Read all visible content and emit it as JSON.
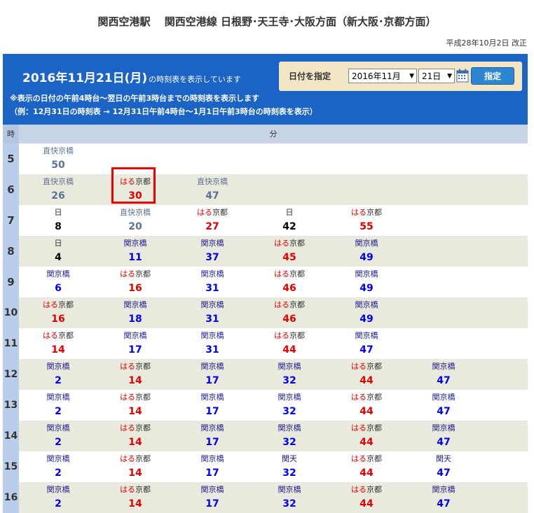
{
  "header": {
    "title": "関西空港駅　 関西空港線  日根野･天王寺･大阪方面（新大阪･京都方面）",
    "revised": "平成28年10月2日  改正"
  },
  "panel": {
    "date": "2016年11月21日(月)",
    "date_suffix": "の時刻表を表示しています",
    "note1": "※表示の日付の午前4時台～翌日の午前3時台までの時刻表を表示します",
    "note2": "（例：12月31日の時刻表  →  12月31日午前4時台～1月1日午前3時台の時刻表を表示）",
    "date_label": "日付を指定",
    "month_value": "2016年11月",
    "day_value": "21日",
    "submit_label": "指定"
  },
  "table": {
    "hour_header": "時",
    "minute_header": "分",
    "rows": [
      {
        "hour": "5",
        "cells": [
          {
            "type": "exp",
            "label": "直快京橋",
            "min": "50"
          }
        ]
      },
      {
        "hour": "6",
        "cells": [
          {
            "type": "exp",
            "label": "直快京橋",
            "min": "26"
          },
          {
            "type": "haruka",
            "label": "はる",
            "dest": "京都",
            "min": "30"
          },
          {
            "type": "exp",
            "label": "直快京橋",
            "min": "47"
          }
        ]
      },
      {
        "hour": "7",
        "cells": [
          {
            "type": "sun",
            "label": "日",
            "min": "8"
          },
          {
            "type": "exp",
            "label": "直快京橋",
            "min": "20"
          },
          {
            "type": "haruka",
            "label": "はる",
            "dest": "京都",
            "min": "27"
          },
          {
            "type": "sun",
            "label": "日",
            "min": "42"
          },
          {
            "type": "haruka",
            "label": "はる",
            "dest": "京都",
            "min": "55"
          }
        ]
      },
      {
        "hour": "8",
        "cells": [
          {
            "type": "sun",
            "label": "日",
            "min": "4"
          },
          {
            "type": "kanku",
            "label": "関京橋",
            "min": "11"
          },
          {
            "type": "kanku",
            "label": "関京橋",
            "min": "37"
          },
          {
            "type": "haruka",
            "label": "はる",
            "dest": "京都",
            "min": "45"
          },
          {
            "type": "kanku",
            "label": "関京橋",
            "min": "49"
          }
        ]
      },
      {
        "hour": "9",
        "cells": [
          {
            "type": "kanku",
            "label": "関京橋",
            "min": "6"
          },
          {
            "type": "haruka",
            "label": "はる",
            "dest": "京都",
            "min": "16"
          },
          {
            "type": "kanku",
            "label": "関京橋",
            "min": "31"
          },
          {
            "type": "haruka",
            "label": "はる",
            "dest": "京都",
            "min": "46"
          },
          {
            "type": "kanku",
            "label": "関京橋",
            "min": "49"
          }
        ]
      },
      {
        "hour": "10",
        "cells": [
          {
            "type": "haruka",
            "label": "はる",
            "dest": "京都",
            "min": "16"
          },
          {
            "type": "kanku",
            "label": "関京橋",
            "min": "18"
          },
          {
            "type": "kanku",
            "label": "関京橋",
            "min": "31"
          },
          {
            "type": "haruka",
            "label": "はる",
            "dest": "京都",
            "min": "46"
          },
          {
            "type": "kanku",
            "label": "関京橋",
            "min": "49"
          }
        ]
      },
      {
        "hour": "11",
        "cells": [
          {
            "type": "haruka",
            "label": "はる",
            "dest": "京都",
            "min": "14"
          },
          {
            "type": "kanku",
            "label": "関京橋",
            "min": "17"
          },
          {
            "type": "kanku",
            "label": "関京橋",
            "min": "31"
          },
          {
            "type": "haruka",
            "label": "はる",
            "dest": "京都",
            "min": "44"
          },
          {
            "type": "kanku",
            "label": "関京橋",
            "min": "47"
          }
        ]
      },
      {
        "hour": "12",
        "cells": [
          {
            "type": "kanku",
            "label": "関京橋",
            "min": "2"
          },
          {
            "type": "haruka",
            "label": "はる",
            "dest": "京都",
            "min": "14"
          },
          {
            "type": "kanku",
            "label": "関京橋",
            "min": "17"
          },
          {
            "type": "kanku",
            "label": "関京橋",
            "min": "32"
          },
          {
            "type": "haruka",
            "label": "はる",
            "dest": "京都",
            "min": "44"
          },
          {
            "type": "kanku",
            "label": "関京橋",
            "min": "47"
          }
        ]
      },
      {
        "hour": "13",
        "cells": [
          {
            "type": "kanku",
            "label": "関京橋",
            "min": "2"
          },
          {
            "type": "haruka",
            "label": "はる",
            "dest": "京都",
            "min": "14"
          },
          {
            "type": "kanku",
            "label": "関京橋",
            "min": "17"
          },
          {
            "type": "kanku",
            "label": "関京橋",
            "min": "32"
          },
          {
            "type": "haruka",
            "label": "はる",
            "dest": "京都",
            "min": "44"
          },
          {
            "type": "kanku",
            "label": "関京橋",
            "min": "47"
          }
        ]
      },
      {
        "hour": "14",
        "cells": [
          {
            "type": "kanku",
            "label": "関京橋",
            "min": "2"
          },
          {
            "type": "haruka",
            "label": "はる",
            "dest": "京都",
            "min": "14"
          },
          {
            "type": "kanku",
            "label": "関京橋",
            "min": "17"
          },
          {
            "type": "kanku",
            "label": "関京橋",
            "min": "32"
          },
          {
            "type": "haruka",
            "label": "はる",
            "dest": "京都",
            "min": "44"
          },
          {
            "type": "kanku",
            "label": "関京橋",
            "min": "47"
          }
        ]
      },
      {
        "hour": "15",
        "cells": [
          {
            "type": "kanku",
            "label": "関京橋",
            "min": "2"
          },
          {
            "type": "haruka",
            "label": "はる",
            "dest": "京都",
            "min": "14"
          },
          {
            "type": "kanku",
            "label": "関京橋",
            "min": "17"
          },
          {
            "type": "kanku",
            "label": "関天",
            "min": "32"
          },
          {
            "type": "haruka",
            "label": "はる",
            "dest": "京都",
            "min": "44"
          },
          {
            "type": "kanku",
            "label": "関天",
            "min": "47"
          }
        ]
      },
      {
        "hour": "16",
        "cells": [
          {
            "type": "kanku",
            "label": "関京橋",
            "min": "2"
          },
          {
            "type": "haruka",
            "label": "はる",
            "dest": "京都",
            "min": "14"
          },
          {
            "type": "kanku",
            "label": "関京橋",
            "min": "17"
          },
          {
            "type": "kanku",
            "label": "関京橋",
            "min": "32"
          },
          {
            "type": "haruka",
            "label": "はる",
            "dest": "京都",
            "min": "44"
          },
          {
            "type": "kanku",
            "label": "関京橋",
            "min": "47"
          }
        ]
      }
    ]
  }
}
